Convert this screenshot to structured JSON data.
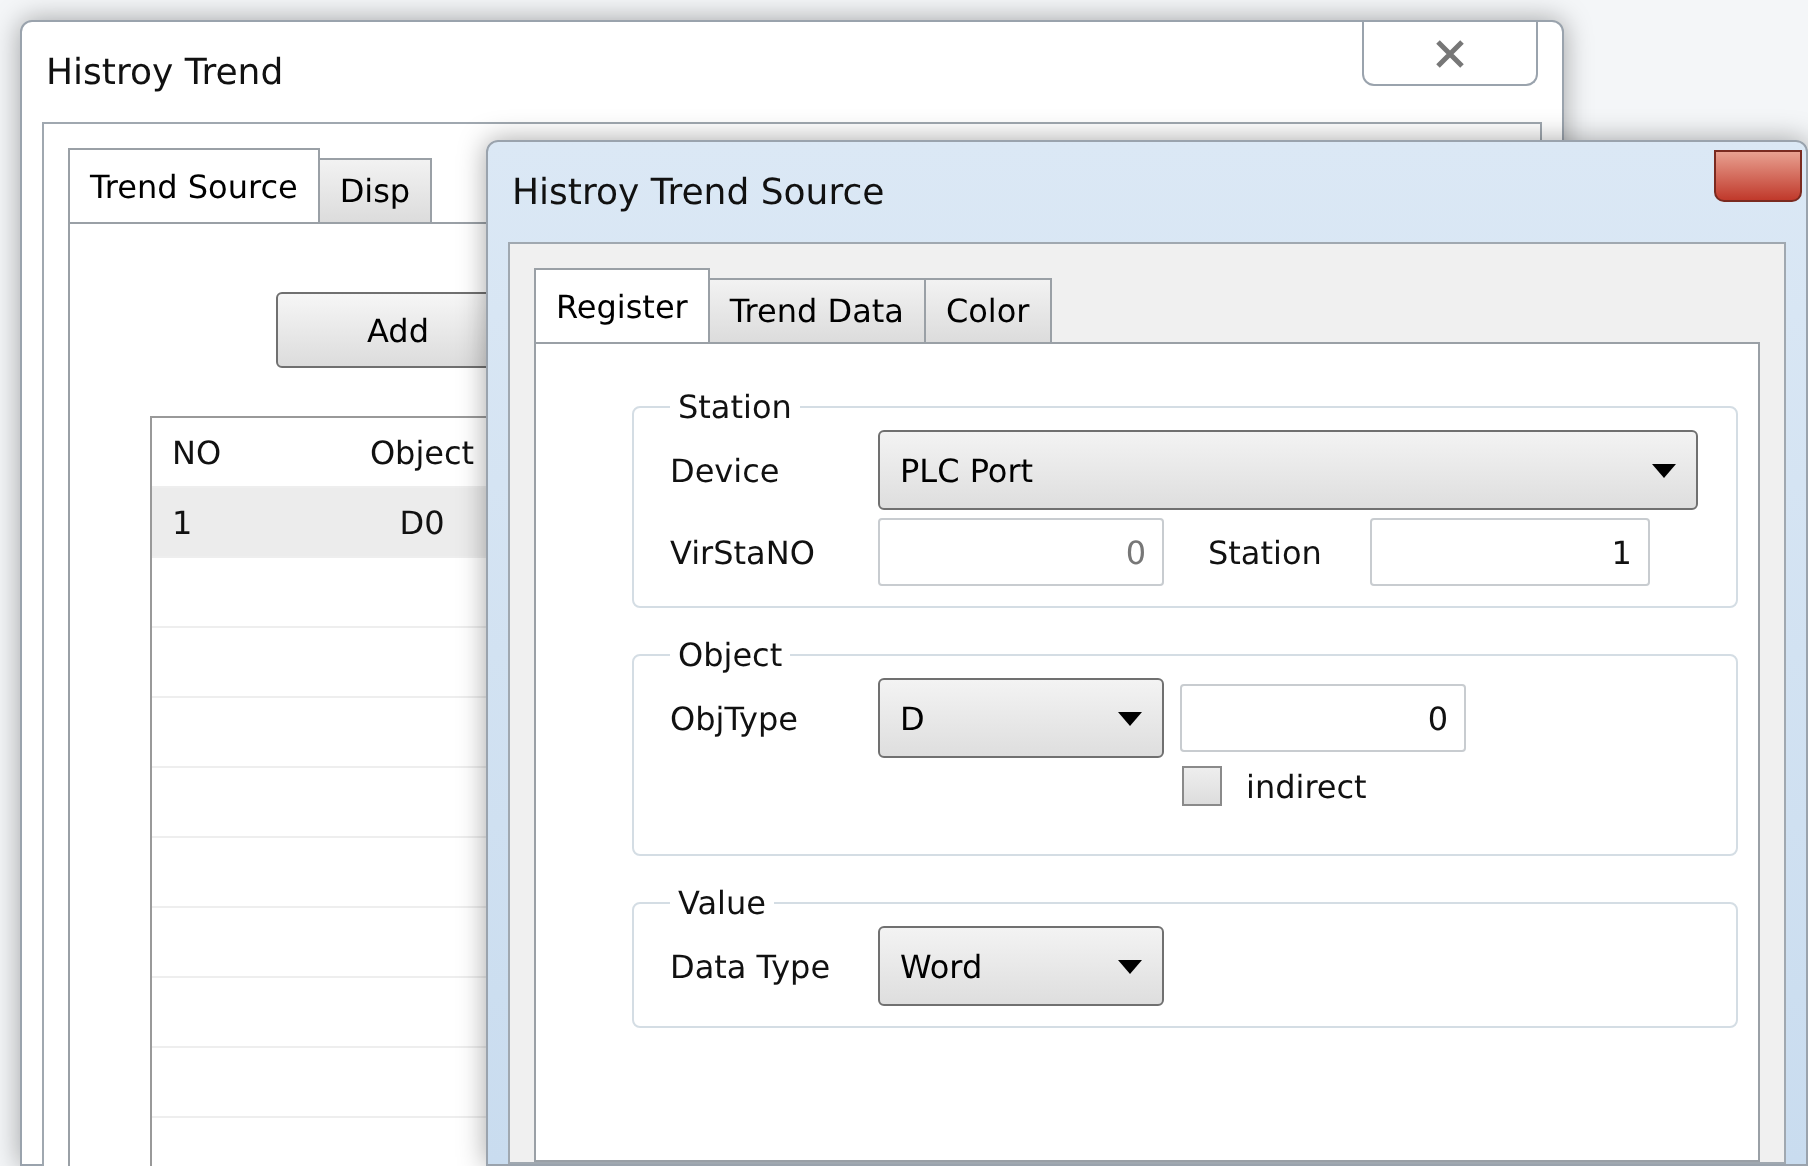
{
  "back_window": {
    "title": "Histroy Trend",
    "tabs": [
      {
        "label": "Trend Source",
        "selected": true
      },
      {
        "label": "Disp",
        "selected": false
      }
    ],
    "add_button": "Add",
    "table": {
      "columns": [
        "NO",
        "Object"
      ],
      "rows": [
        {
          "cells": [
            "1",
            "D0"
          ],
          "selected": true
        }
      ]
    }
  },
  "front_window": {
    "title": "Histroy Trend Source",
    "tabs": [
      {
        "label": "Register",
        "selected": true
      },
      {
        "label": "Trend Data",
        "selected": false
      },
      {
        "label": "Color",
        "selected": false
      }
    ],
    "station": {
      "legend": "Station",
      "device_label": "Device",
      "device": "PLC Port",
      "virstano_label": "VirStaNO",
      "virstano": "0",
      "station_label": "Station",
      "station": "1"
    },
    "object": {
      "legend": "Object",
      "objtype_label": "ObjType",
      "objtype": "D",
      "address": "0",
      "indirect_label": "indirect",
      "indirect": false
    },
    "value": {
      "legend": "Value",
      "datatype_label": "Data Type",
      "datatype": "Word"
    }
  }
}
